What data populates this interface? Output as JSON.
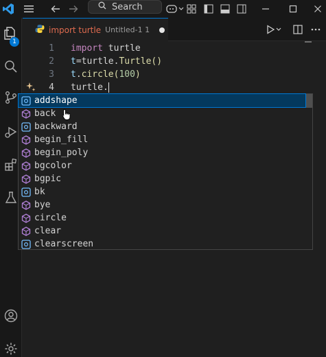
{
  "titlebar": {
    "search_label": "Search"
  },
  "activity_bar": {
    "explorer_badge": "1"
  },
  "tab": {
    "label": "import turtle",
    "description": "Untitled-1",
    "index": "1"
  },
  "editor": {
    "line_numbers": [
      "1",
      "2",
      "3",
      "4"
    ],
    "line1": {
      "keyword": "import",
      "module": " turtle"
    },
    "line2": {
      "var": "t",
      "op": "=",
      "module": "turtle",
      "dot": ".",
      "cls": "Turtle",
      "parens": "()"
    },
    "line3": {
      "var": "t",
      "dot": ".",
      "func": "circle",
      "open": "(",
      "num": "100",
      "close": ")"
    },
    "line4": {
      "text": "turtle."
    }
  },
  "suggestions": [
    {
      "label": "addshape",
      "kind": "method"
    },
    {
      "label": "back",
      "kind": "function"
    },
    {
      "label": "backward",
      "kind": "method"
    },
    {
      "label": "begin_fill",
      "kind": "function"
    },
    {
      "label": "begin_poly",
      "kind": "function"
    },
    {
      "label": "bgcolor",
      "kind": "function"
    },
    {
      "label": "bgpic",
      "kind": "function"
    },
    {
      "label": "bk",
      "kind": "method"
    },
    {
      "label": "bye",
      "kind": "function"
    },
    {
      "label": "circle",
      "kind": "function"
    },
    {
      "label": "clear",
      "kind": "function"
    },
    {
      "label": "clearscreen",
      "kind": "method"
    }
  ],
  "colors": {
    "accent": "#0078d4",
    "selected_row": "#04395e",
    "method_icon": "#75beff",
    "function_icon": "#b180d7",
    "tab_label": "#e06b4f"
  }
}
